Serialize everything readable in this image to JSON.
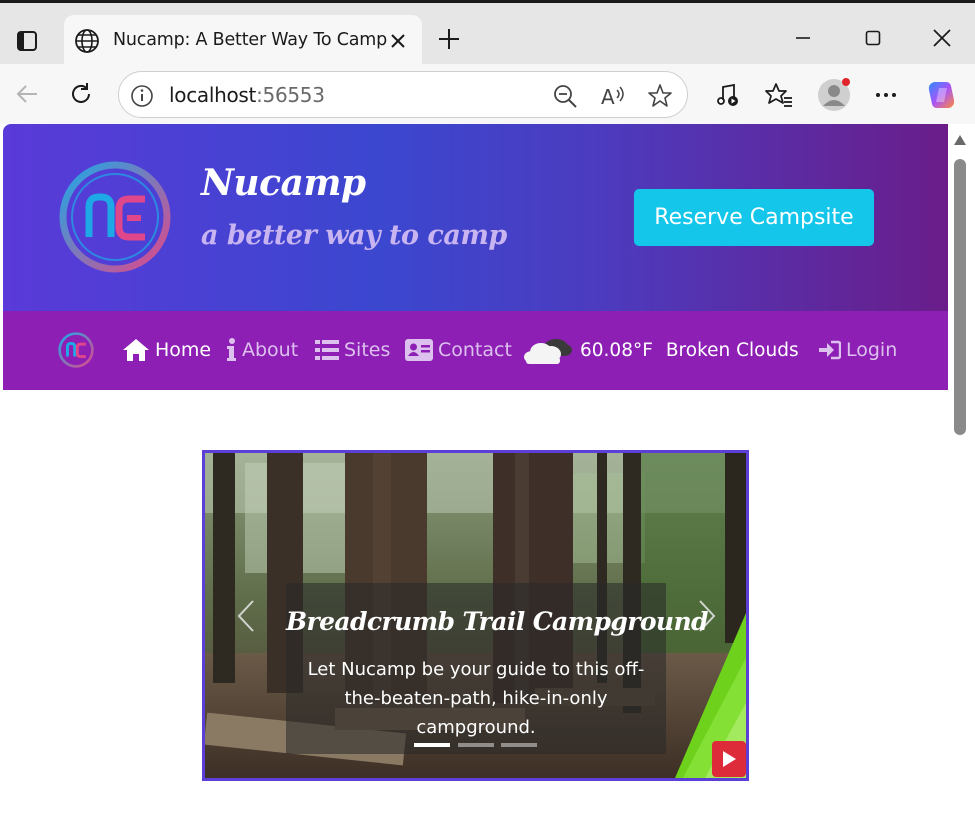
{
  "browser": {
    "tab_title": "Nucamp: A Better Way To Camp",
    "url_host": "localhost",
    "url_port": ":56553"
  },
  "site": {
    "brand_name": "Nucamp",
    "tagline": "a better way to camp",
    "reserve_label": "Reserve Campsite",
    "nav": {
      "home": "Home",
      "about": "About",
      "sites": "Sites",
      "contact": "Contact",
      "login": "Login"
    },
    "weather": {
      "temperature": "60.08°F",
      "description": "Broken Clouds",
      "icon": "broken-clouds-icon"
    }
  },
  "carousel": {
    "slide_title": "Breadcrumb Trail Campground",
    "slide_text": "Let Nucamp be your guide to this off-the-beaten-path, hike-in-only campground.",
    "slide_count": 3,
    "active_slide": 1
  },
  "colors": {
    "hero_gradient_start": "#5a3ad8",
    "hero_gradient_end": "#6a1d8a",
    "nav_bg": "#8e1fb4",
    "reserve_button": "#14c6ea",
    "carousel_border": "#5b3fd6",
    "youtube_red": "#dd2b3a"
  }
}
